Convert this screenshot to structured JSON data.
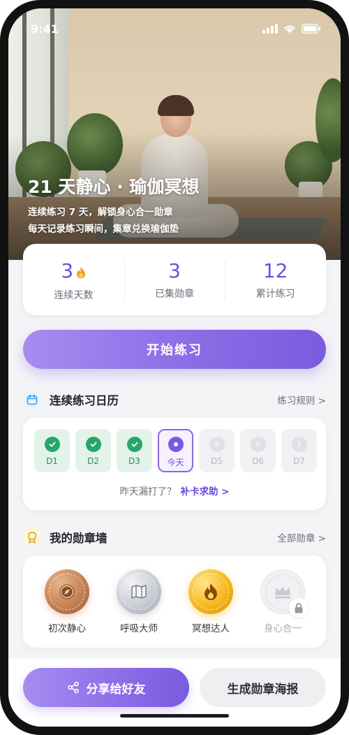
{
  "status_bar": {
    "time": "9:41"
  },
  "hero": {
    "title": "21 天静心 · 瑜伽冥想",
    "subtitle_line1": "连续练习 7 天，解锁身心合一勋章",
    "subtitle_line2": "每天记录练习瞬间，集章兑换瑜伽垫"
  },
  "stats": [
    {
      "value": "3",
      "label": "连续天数",
      "icon": "flame-icon"
    },
    {
      "value": "3",
      "label": "已集勋章"
    },
    {
      "value": "12",
      "label": "累计练习"
    }
  ],
  "start_button": {
    "label": "开始练习"
  },
  "calendar": {
    "title": "连续练习日历",
    "more": "练习规则 >",
    "days": [
      {
        "label": "D1",
        "state": "done"
      },
      {
        "label": "D2",
        "state": "done"
      },
      {
        "label": "D3",
        "state": "done"
      },
      {
        "label": "今天",
        "state": "today"
      },
      {
        "label": "D5",
        "num": "5",
        "state": "future"
      },
      {
        "label": "D6",
        "num": "6",
        "state": "future"
      },
      {
        "label": "D7",
        "num": "7",
        "state": "future"
      }
    ],
    "note": "昨天漏打了？",
    "note_link": "补卡求助 >"
  },
  "badges": {
    "title": "我的勋章墙",
    "more": "全部勋章 >",
    "items": [
      {
        "label": "初次静心",
        "icon": "compass-icon",
        "tier": "bronze",
        "locked": false
      },
      {
        "label": "呼吸大师",
        "icon": "map-icon",
        "tier": "silver",
        "locked": false
      },
      {
        "label": "冥想达人",
        "icon": "flame-icon",
        "tier": "gold",
        "locked": false
      },
      {
        "label": "身心合一",
        "icon": "crown-icon",
        "tier": "locked",
        "locked": true
      }
    ]
  },
  "actions": {
    "share_label": "分享给好友",
    "poster_label": "生成勋章海报"
  },
  "colors": {
    "accent": "#7b59df",
    "accent_light": "#a68cf0",
    "done_green": "#27a66a",
    "gold": "#f6b81c"
  }
}
